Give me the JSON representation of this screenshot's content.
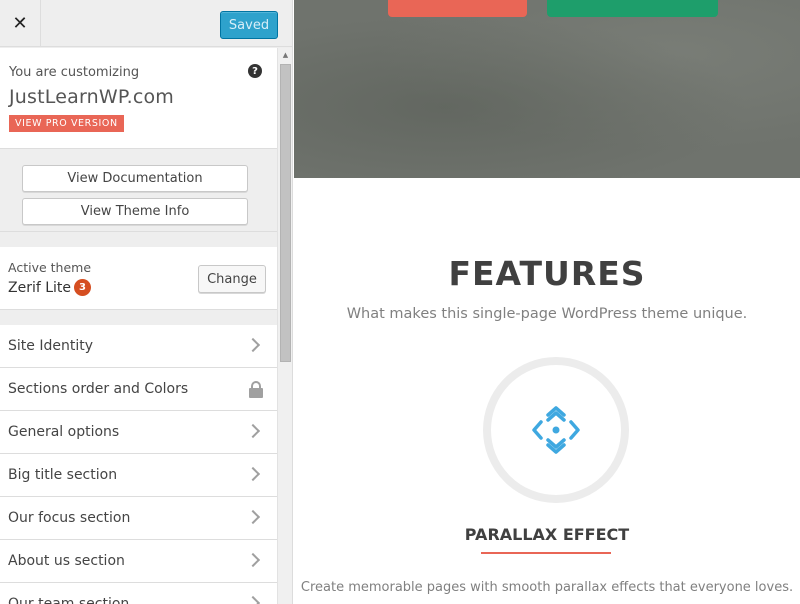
{
  "topbar": {
    "close_symbol": "✕",
    "saved_label": "Saved"
  },
  "info": {
    "customizing_label": "You are customizing",
    "help_symbol": "?",
    "site_title": "JustLearnWP.com",
    "pro_badge": "VIEW PRO VERSION"
  },
  "docs": {
    "view_documentation": "View Documentation",
    "view_theme_info": "View Theme Info"
  },
  "theme": {
    "active_label": "Active theme",
    "name": "Zerif Lite",
    "count": "3",
    "change_label": "Change"
  },
  "sections": {
    "items": [
      {
        "label": "Site Identity",
        "icon": "chevron-right-icon"
      },
      {
        "label": "Sections order and Colors",
        "icon": "lock-icon"
      },
      {
        "label": "General options",
        "icon": "chevron-right-icon"
      },
      {
        "label": "Big title section",
        "icon": "chevron-right-icon"
      },
      {
        "label": "Our focus section",
        "icon": "chevron-right-icon"
      },
      {
        "label": "About us section",
        "icon": "chevron-right-icon"
      },
      {
        "label": "Our team section",
        "icon": "chevron-right-icon"
      }
    ]
  },
  "preview": {
    "features_title": "FEATURES",
    "features_subtitle": "What makes this single-page WordPress theme unique.",
    "feature_icon": "parallax-arrows-icon",
    "feature_title": "PARALLAX EFFECT",
    "feature_desc": "Create memorable pages with smooth parallax effects that everyone loves."
  },
  "colors": {
    "accent_blue": "#2ea2cc",
    "brand_red": "#e96656",
    "brand_green": "#1e9e6b",
    "icon_blue": "#3fa8e0",
    "badge_orange": "#d54e21"
  }
}
